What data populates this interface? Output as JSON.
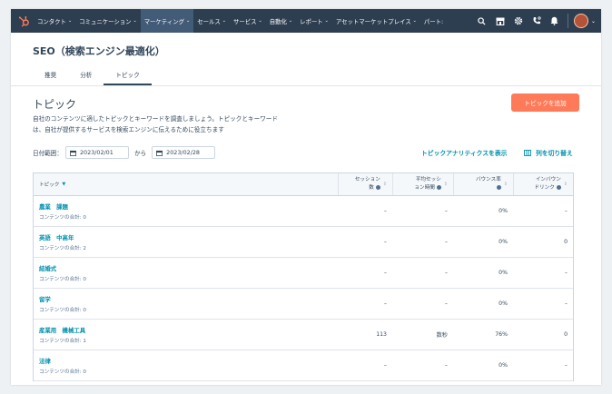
{
  "nav": {
    "items": [
      {
        "label": "コンタクト",
        "active": false
      },
      {
        "label": "コミュニケーション",
        "active": false
      },
      {
        "label": "マーケティング",
        "active": true
      },
      {
        "label": "セールス",
        "active": false
      },
      {
        "label": "サービス",
        "active": false
      },
      {
        "label": "自動化",
        "active": false
      },
      {
        "label": "レポート",
        "active": false
      },
      {
        "label": "アセットマーケットプレイス",
        "active": false
      },
      {
        "label": "パート:",
        "active": false
      }
    ],
    "chevron": "⌄"
  },
  "page": {
    "title": "SEO（検索エンジン最適化）",
    "tabs": [
      {
        "label": "推奨",
        "active": false
      },
      {
        "label": "分析",
        "active": false
      },
      {
        "label": "トピック",
        "active": true
      }
    ]
  },
  "section": {
    "title": "トピック",
    "description_line1": "自社のコンテンツに適したトピックとキーワードを調査しましょう。トピックとキーワード",
    "description_line2": "は、自社が提供するサービスを検索エンジンに伝えるために役立ちます",
    "add_button": "トピックを追加"
  },
  "dates": {
    "label": "日付範囲：",
    "start": "2023/02/01",
    "separator": "から",
    "end": "2023/02/28"
  },
  "links": {
    "analytics": "トピックアナリティクスを表示",
    "toggle_columns": "列を切り替え"
  },
  "table": {
    "headers": {
      "topic": "トピック",
      "sessions_line1": "セッション",
      "sessions_line2": "数",
      "avg_line1": "平均セッシ",
      "avg_line2": "ョン時間",
      "bounce": "バウンス率",
      "inbound_line1": "インバウン",
      "inbound_line2": "ドリンク"
    },
    "rows": [
      {
        "name": "農業　課題",
        "sub": "コンテンツの合計: 0",
        "sessions": "–",
        "avg": "–",
        "bounce": "0%",
        "inbound": "–"
      },
      {
        "name": "英語　中高年",
        "sub": "コンテンツの合計: 2",
        "sessions": "–",
        "avg": "–",
        "bounce": "0%",
        "inbound": "0"
      },
      {
        "name": "結婚式",
        "sub": "コンテンツの合計: 0",
        "sessions": "–",
        "avg": "–",
        "bounce": "0%",
        "inbound": "–"
      },
      {
        "name": "留学",
        "sub": "コンテンツの合計: 0",
        "sessions": "–",
        "avg": "–",
        "bounce": "0%",
        "inbound": "–"
      },
      {
        "name": "産業用　機械工具",
        "sub": "コンテンツの合計: 1",
        "sessions": "113",
        "avg": "数秒",
        "bounce": "76%",
        "inbound": "0"
      },
      {
        "name": "法律",
        "sub": "コンテンツの合計: 0",
        "sessions": "–",
        "avg": "–",
        "bounce": "0%",
        "inbound": "–"
      }
    ]
  },
  "colors": {
    "nav_bg": "#2d3e50",
    "accent": "#ff7a59",
    "link": "#0091ae"
  }
}
